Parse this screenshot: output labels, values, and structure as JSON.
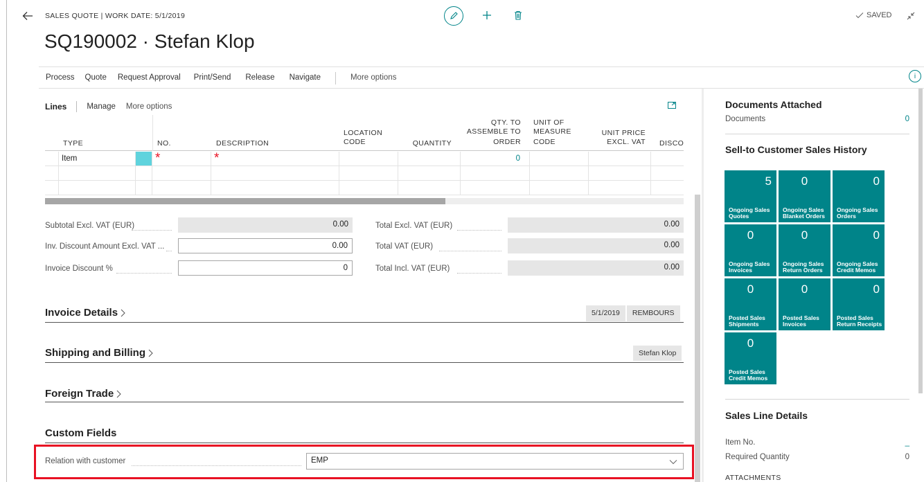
{
  "header": {
    "context": "SALES QUOTE | WORK DATE: 5/1/2019",
    "title": "SQ190002 · Stefan Klop",
    "saved": "SAVED"
  },
  "actions": [
    "Process",
    "Quote",
    "Request Approval",
    "Print/Send",
    "Release",
    "Navigate"
  ],
  "actions_more": "More options",
  "lines": {
    "title": "Lines",
    "manage": "Manage",
    "more": "More options",
    "columns": {
      "type": "TYPE",
      "no": "NO.",
      "description": "DESCRIPTION",
      "location1": "LOCATION",
      "location2": "CODE",
      "quantity": "QUANTITY",
      "assemble1": "QTY. TO",
      "assemble2": "ASSEMBLE TO",
      "assemble3": "ORDER",
      "uom1": "UNIT OF",
      "uom2": "MEASURE",
      "uom3": "CODE",
      "price1": "UNIT PRICE",
      "price2": "EXCL. VAT",
      "discount": "DISCOU"
    },
    "row1": {
      "type": "Item",
      "assemble": "0"
    }
  },
  "totals": {
    "subtotal_label": "Subtotal Excl. VAT (EUR)",
    "subtotal_value": "0.00",
    "inv_disc_label": "Inv. Discount Amount Excl. VAT ...",
    "inv_disc_value": "0.00",
    "inv_disc_pct_label": "Invoice Discount %",
    "inv_disc_pct_value": "0",
    "total_excl_label": "Total Excl. VAT (EUR)",
    "total_excl_value": "0.00",
    "total_vat_label": "Total VAT (EUR)",
    "total_vat_value": "0.00",
    "total_incl_label": "Total Incl. VAT (EUR)",
    "total_incl_value": "0.00"
  },
  "sections": {
    "invoice_details": "Invoice Details",
    "invoice_date": "5/1/2019",
    "invoice_payment": "REMBOURS",
    "shipping": "Shipping and Billing",
    "shipping_name": "Stefan Klop",
    "foreign_trade": "Foreign Trade",
    "custom_fields": "Custom Fields"
  },
  "custom": {
    "relation_label": "Relation with customer",
    "relation_value": "EMP"
  },
  "factbox": {
    "docs_title": "Documents Attached",
    "docs_label": "Documents",
    "docs_value": "0",
    "history_title": "Sell-to Customer Sales History",
    "tiles": [
      {
        "value": "5",
        "line1": "Ongoing Sales",
        "line2": "Quotes"
      },
      {
        "value": "0",
        "line1": "Ongoing Sales",
        "line2": "Blanket Orders"
      },
      {
        "value": "0",
        "line1": "Ongoing Sales",
        "line2": "Orders"
      },
      {
        "value": "0",
        "line1": "Ongoing Sales",
        "line2": "Invoices"
      },
      {
        "value": "0",
        "line1": "Ongoing Sales",
        "line2": "Return Orders"
      },
      {
        "value": "0",
        "line1": "Ongoing Sales",
        "line2": "Credit Memos"
      },
      {
        "value": "0",
        "line1": "Posted Sales",
        "line2": "Shipments"
      },
      {
        "value": "0",
        "line1": "Posted Sales",
        "line2": "Invoices"
      },
      {
        "value": "0",
        "line1": "Posted Sales",
        "line2": "Return Receipts"
      },
      {
        "value": "0",
        "line1": "Posted Sales",
        "line2": "Credit Memos"
      }
    ],
    "line_details_title": "Sales Line Details",
    "item_no_label": "Item No.",
    "item_no_value": "_",
    "req_qty_label": "Required Quantity",
    "req_qty_value": "0",
    "attachments": "ATTACHMENTS"
  },
  "colors": {
    "accent": "#008489",
    "required": "#e81123",
    "highlight": "#e81123"
  }
}
